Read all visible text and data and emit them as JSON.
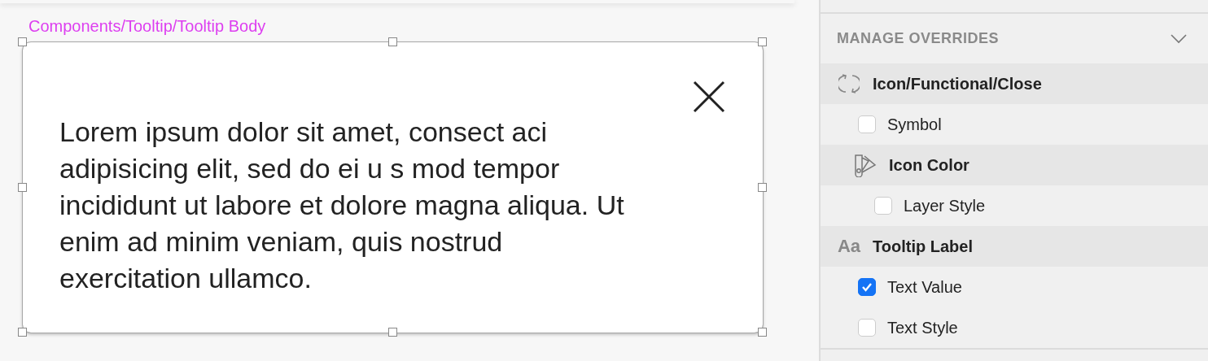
{
  "canvas": {
    "artboard_label": "Components/Tooltip/Tooltip Body",
    "tooltip": {
      "text": "Lorem ipsum dolor sit amet, consect aci adipisicing elit, sed do ei u s mod tempor incididunt ut labore et dolore magna aliqua. Ut enim ad minim veniam, quis nostrud exercitation ullamco.",
      "selected": true
    }
  },
  "inspector": {
    "section_title": "MANAGE OVERRIDES",
    "expanded": true,
    "overrides": [
      {
        "kind": "symbol",
        "label": "Icon/Functional/Close",
        "children": [
          {
            "kind": "option",
            "label": "Symbol",
            "checked": false
          },
          {
            "kind": "swatch",
            "label": "Icon Color",
            "children": [
              {
                "kind": "option",
                "label": "Layer Style",
                "checked": false
              }
            ]
          }
        ]
      },
      {
        "kind": "text",
        "icon_text": "Aa",
        "label": "Tooltip Label",
        "children": [
          {
            "kind": "option",
            "label": "Text Value",
            "checked": true
          },
          {
            "kind": "option",
            "label": "Text Style",
            "checked": false
          }
        ]
      }
    ]
  }
}
